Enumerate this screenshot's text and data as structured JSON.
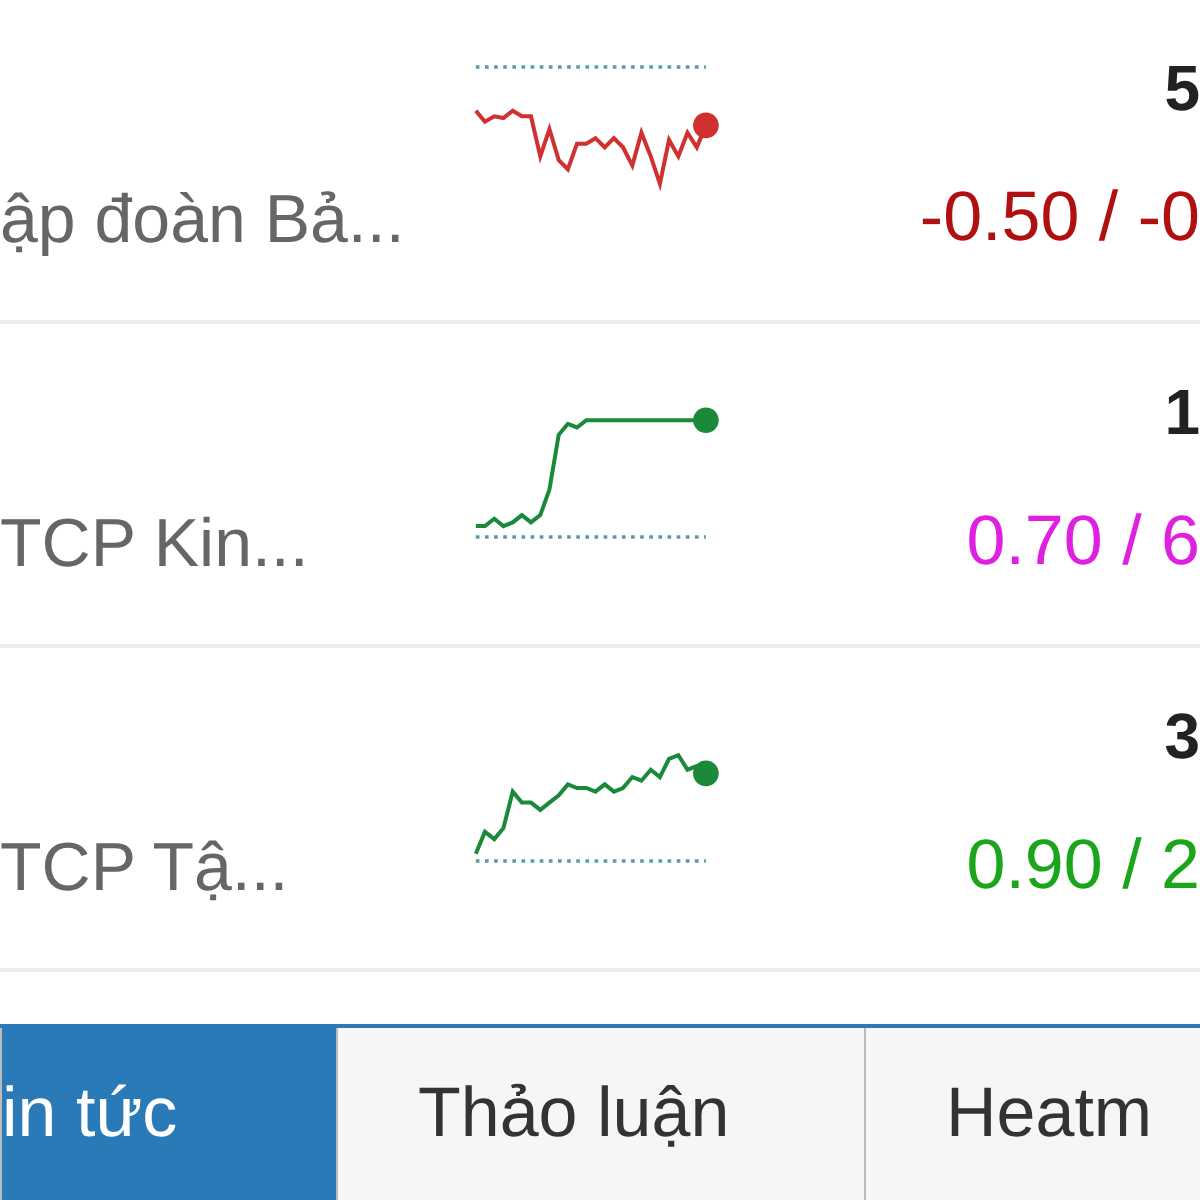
{
  "stocks": [
    {
      "kind": "volatile",
      "name": "ập đoàn Bả...",
      "price": "5",
      "change": "-0.50 / -0",
      "color": "#b01010"
    },
    {
      "kind": "jump",
      "name": "TCP Kin...",
      "price": "1",
      "change": "0.70 / 6",
      "color": "#e020e0"
    },
    {
      "kind": "rise",
      "name": "TCP Tậ...",
      "price": "3",
      "change": "0.90 / 2",
      "color": "#1aa51a"
    }
  ],
  "tabs": [
    {
      "label": "in tức",
      "selected": true
    },
    {
      "label": "Thảo luận",
      "selected": false
    },
    {
      "label": "Heatm",
      "selected": false
    }
  ]
}
